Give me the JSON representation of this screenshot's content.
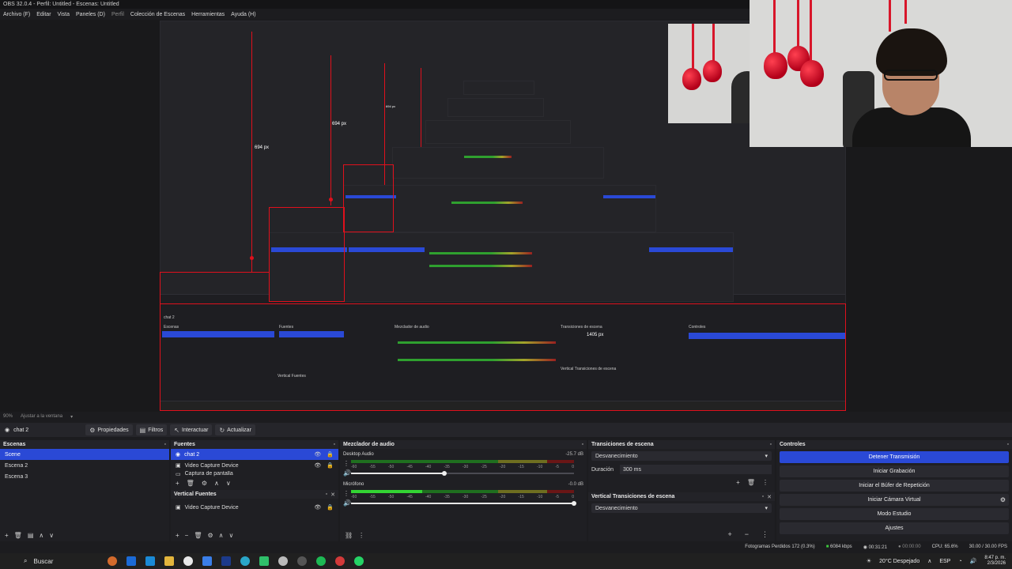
{
  "window": {
    "title": "OBS 32.0.4 - Perfil: Untitled - Escenas: Untitled"
  },
  "menu": [
    "Archivo (F)",
    "Editar",
    "Vista",
    "Paneles (D)",
    "Perfil",
    "Colección de Escenas",
    "Herramientas",
    "Ayuda (H)"
  ],
  "preview": {
    "labels": [
      "694 px",
      "694 px",
      "694 px",
      "1405 px"
    ],
    "zoom": "90%",
    "fit_label": "Ajustar a la ventana"
  },
  "toolbar": {
    "current_scene": "chat 2",
    "buttons": [
      "Propiedades",
      "Filtros",
      "Interactuar",
      "Actualizar"
    ]
  },
  "scenes": {
    "title": "Escenas",
    "items": [
      "Scene",
      "Escena 2",
      "Escena 3"
    ],
    "selected": 0
  },
  "sources": {
    "title": "Fuentes",
    "items": [
      "chat 2",
      "Video Capture Device",
      "Captura de pantalla"
    ],
    "selected": 0
  },
  "vertical_sources": {
    "title": "Vertical Fuentes",
    "items": [
      "Video Capture Device"
    ]
  },
  "mixer": {
    "title": "Mezclador de audio",
    "channels": [
      {
        "name": "Desktop Audio",
        "db": "-25.7 dB",
        "level": 0.0,
        "volume": 0.42
      },
      {
        "name": "Micrófono",
        "db": "-0.0 dB",
        "level": 0.32,
        "volume": 1.0
      }
    ],
    "scale": [
      "-60",
      "-55",
      "-50",
      "-45",
      "-40",
      "-35",
      "-30",
      "-25",
      "-20",
      "-15",
      "-10",
      "-5",
      "0"
    ]
  },
  "transitions": {
    "title": "Transiciones de escena",
    "selected": "Desvanecimiento",
    "duration_label": "Duración",
    "duration_value": "300 ms"
  },
  "vertical_transitions": {
    "title": "Vertical Transiciones de escena",
    "selected": "Desvanecimiento"
  },
  "controls": {
    "title": "Controles",
    "buttons": [
      "Detener Transmisión",
      "Iniciar Grabación",
      "Iniciar el Búfer de Repetición",
      "Iniciar Cámara Virtual",
      "Modo Estudio",
      "Ajustes"
    ]
  },
  "status": {
    "dropped": "Fotogramas Perdidos 172 (0.3%)",
    "bitrate": "6084 kbps",
    "stream_time": "00:31:21",
    "rec_time": "00:00:00",
    "cpu": "CPU: 65.6%",
    "fps": "30.00 / 30.00 FPS"
  },
  "taskbar": {
    "search": "Buscar",
    "weather": "20°C  Despejado",
    "lang": "ESP",
    "time": "8:47 p. m.",
    "date": "2/3/2026"
  },
  "colors": {
    "accent": "#2a49d6",
    "guide": "#e0101c"
  }
}
